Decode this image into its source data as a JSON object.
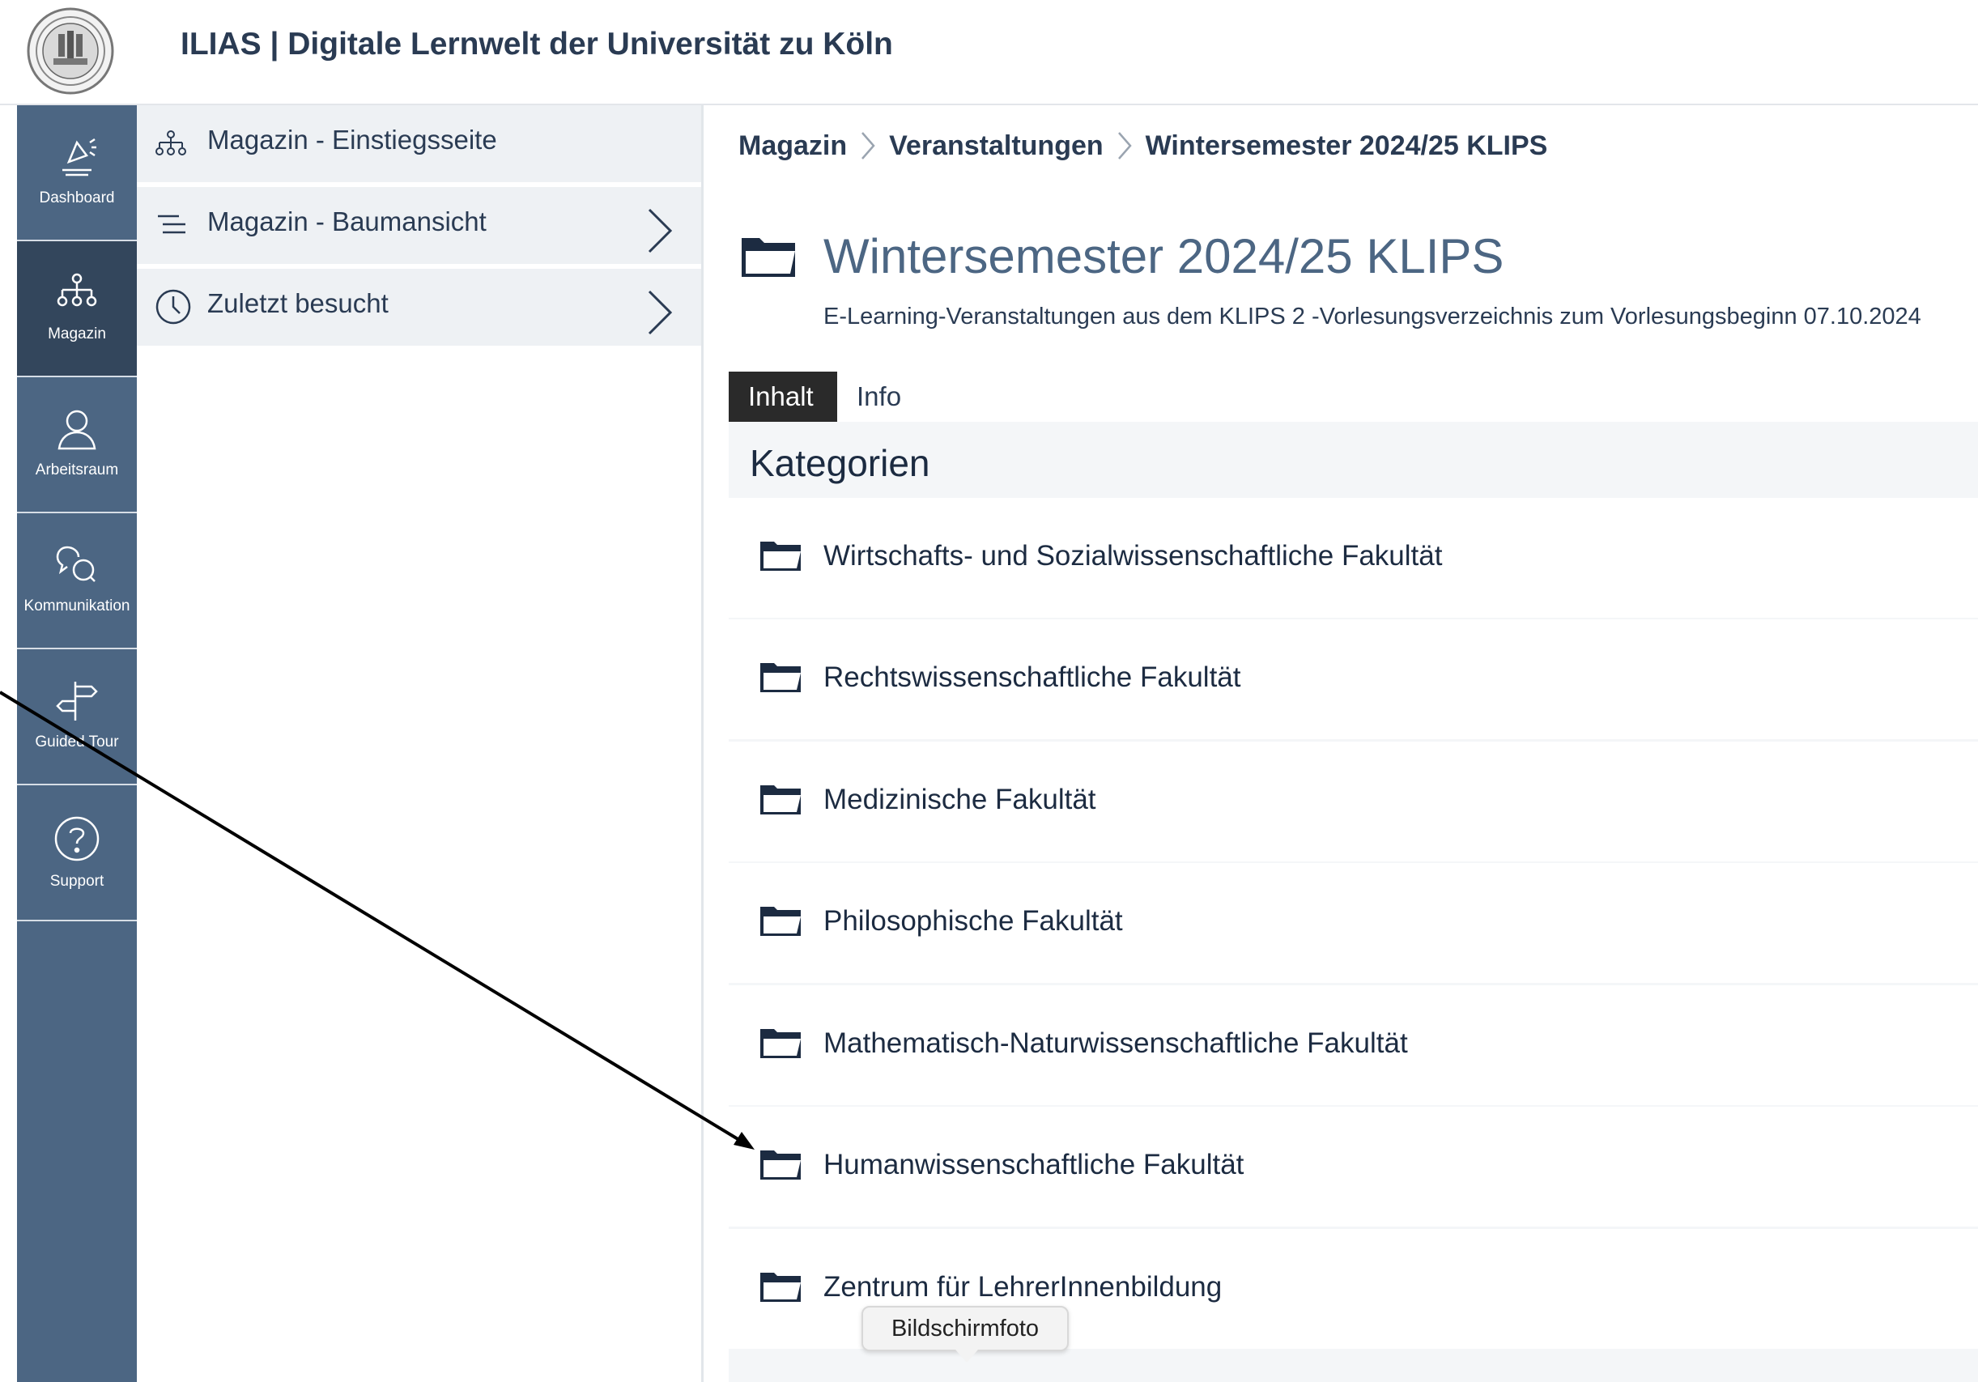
{
  "header": {
    "title": "ILIAS | Digitale Lernwelt der Universität zu Köln",
    "logo_icon": "university-seal-icon"
  },
  "mainbar": {
    "items": [
      {
        "label": "Dashboard",
        "icon": "dashboard-icon"
      },
      {
        "label": "Magazin",
        "icon": "repository-icon",
        "active": true
      },
      {
        "label": "Arbeitsraum",
        "icon": "user-icon"
      },
      {
        "label": "Kommunikation",
        "icon": "chat-icon"
      },
      {
        "label": "Guided Tour",
        "icon": "signpost-icon"
      },
      {
        "label": "Support",
        "icon": "help-icon"
      }
    ]
  },
  "slate": {
    "items": [
      {
        "label": "Magazin - Einstiegsseite",
        "icon": "sitemap-icon"
      },
      {
        "label": "Magazin - Baumansicht",
        "icon": "tree-list-icon"
      },
      {
        "label": "Zuletzt besucht",
        "icon": "clock-icon"
      }
    ]
  },
  "breadcrumb": [
    "Magazin",
    "Veranstaltungen",
    "Wintersemester 2024/25 KLIPS"
  ],
  "page": {
    "title": "Wintersemester 2024/25 KLIPS",
    "description": "E-Learning-Veranstaltungen aus dem KLIPS 2 -Vorlesungsverzeichnis zum Vorlesungsbeginn 07.10.2024"
  },
  "tabs": [
    {
      "label": "Inhalt",
      "active": true
    },
    {
      "label": "Info",
      "active": false
    }
  ],
  "section_title": "Kategorien",
  "categories": [
    "Wirtschafts- und Sozialwissenschaftliche Fakultät",
    "Rechtswissenschaftliche Fakultät",
    "Medizinische Fakultät",
    "Philosophische Fakultät",
    "Mathematisch-Naturwissenschaftliche Fakultät",
    "Humanwissenschaftliche Fakultät",
    "Zentrum für LehrerInnenbildung"
  ],
  "tooltip": "Bildschirmfoto",
  "colors": {
    "mainbar": "#4c6683",
    "mainbar_active": "#33465c",
    "title": "#4c6683",
    "folder": "#1c2b41"
  }
}
